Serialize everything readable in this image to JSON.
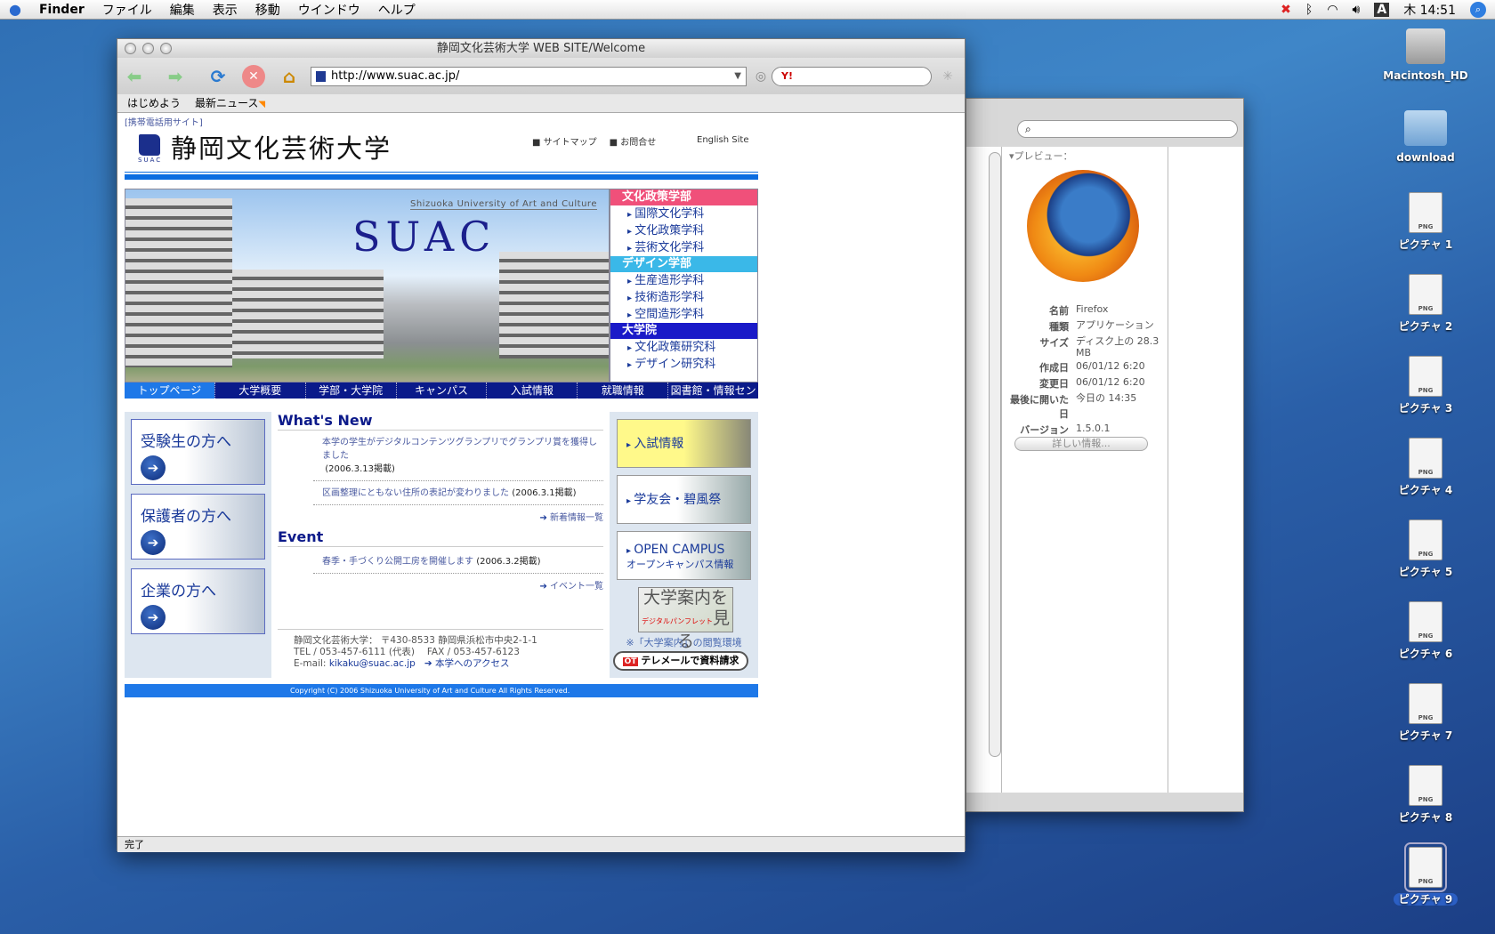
{
  "menubar": {
    "app": "Finder",
    "items": [
      "ファイル",
      "編集",
      "表示",
      "移動",
      "ウインドウ",
      "ヘルプ"
    ],
    "clock": "木 14:51",
    "input_indicator": "A"
  },
  "desktop": {
    "icons": [
      "Macintosh_HD",
      "download",
      "ピクチャ 1",
      "ピクチャ 2",
      "ピクチャ 3",
      "ピクチャ 4",
      "ピクチャ 5",
      "ピクチャ 6",
      "ピクチャ 7",
      "ピクチャ 8",
      "ピクチャ 9"
    ]
  },
  "finder": {
    "preview_label": "▾プレビュー：",
    "info": [
      {
        "k": "名前",
        "v": "Firefox"
      },
      {
        "k": "種類",
        "v": "アプリケーション"
      },
      {
        "k": "サイズ",
        "v": "ディスク上の 28.3 MB"
      },
      {
        "k": "作成日",
        "v": "06/01/12 6:20"
      },
      {
        "k": "変更日",
        "v": "06/01/12 6:20"
      },
      {
        "k": "最後に開いた日",
        "v": "今日の 14:35"
      },
      {
        "k": "バージョン",
        "v": "1.5.0.1"
      }
    ],
    "more_button": "詳しい情報..."
  },
  "browser": {
    "title": "静岡文化芸術大学 WEB SITE/Welcome",
    "url": "http://www.suac.ac.jp/",
    "search_engine": "Y!",
    "bookmarks": [
      "はじめよう",
      "最新ニュース"
    ],
    "status": "完了"
  },
  "site": {
    "mobile_link": "[携帯電話用サイト]",
    "logo_name": "静岡文化芸術大学",
    "logo_abbr": "SUAC",
    "header_links": [
      "■ サイトマップ",
      "■ お問合せ"
    ],
    "english": "English Site",
    "hero_sub": "Shizuoka University of Art and Culture",
    "hero_title": "SUAC",
    "depts": [
      {
        "name": "文化政策学部",
        "color": "#f0507a",
        "items": [
          "国際文化学科",
          "文化政策学科",
          "芸術文化学科"
        ]
      },
      {
        "name": "デザイン学部",
        "color": "#3ab8e8",
        "items": [
          "生産造形学科",
          "技術造形学科",
          "空間造形学科"
        ]
      },
      {
        "name": "大学院",
        "color": "#1a1ac8",
        "items": [
          "文化政策研究科",
          "デザイン研究科"
        ]
      }
    ],
    "nav": [
      "トップページ",
      "大学概要",
      "学部・大学院",
      "キャンパス",
      "入試情報",
      "就職情報",
      "図書館・情報センター"
    ],
    "targets": [
      "受験生の方へ",
      "保護者の方へ",
      "企業の方へ"
    ],
    "whats_new": {
      "title": "What's New",
      "items": [
        {
          "text": "本学の学生がデジタルコンテンツグランプリでグランプリ賞を獲得しました",
          "date": "(2006.3.13掲載)"
        },
        {
          "text": "区画整理にともない住所の表記が変わりました",
          "date": "(2006.3.1掲載)"
        }
      ],
      "more": "新着情報一覧"
    },
    "event": {
      "title": "Event",
      "items": [
        {
          "text": "春季・手づくり公開工房を開催します",
          "date": "(2006.3.2掲載)"
        }
      ],
      "more": "イベント一覧"
    },
    "address": {
      "line1": "静岡文化芸術大学： 〒430-8533 静岡県浜松市中央2-1-1",
      "line2": "TEL / 053-457-6111 (代表)　 FAX / 053-457-6123",
      "email_label": "E-mail:",
      "email": "kikaku@suac.ac.jp",
      "access": "➔ 本学へのアクセス"
    },
    "right_banners": [
      "入試情報",
      "学友会・碧風祭",
      "OPEN CAMPUS",
      "オープンキャンパス情報"
    ],
    "pamphlet": {
      "line1": "大学案内を",
      "small": "デジタルパンフレット",
      "line2": "見る"
    },
    "pamphlet_note": "※「大学案内」の閲覧環境",
    "telemail_icon": "OT",
    "telemail": "テレメールで資料請求",
    "copyright": "Copyright (C) 2006 Shizuoka University of Art and Culture All Rights Reserved."
  }
}
